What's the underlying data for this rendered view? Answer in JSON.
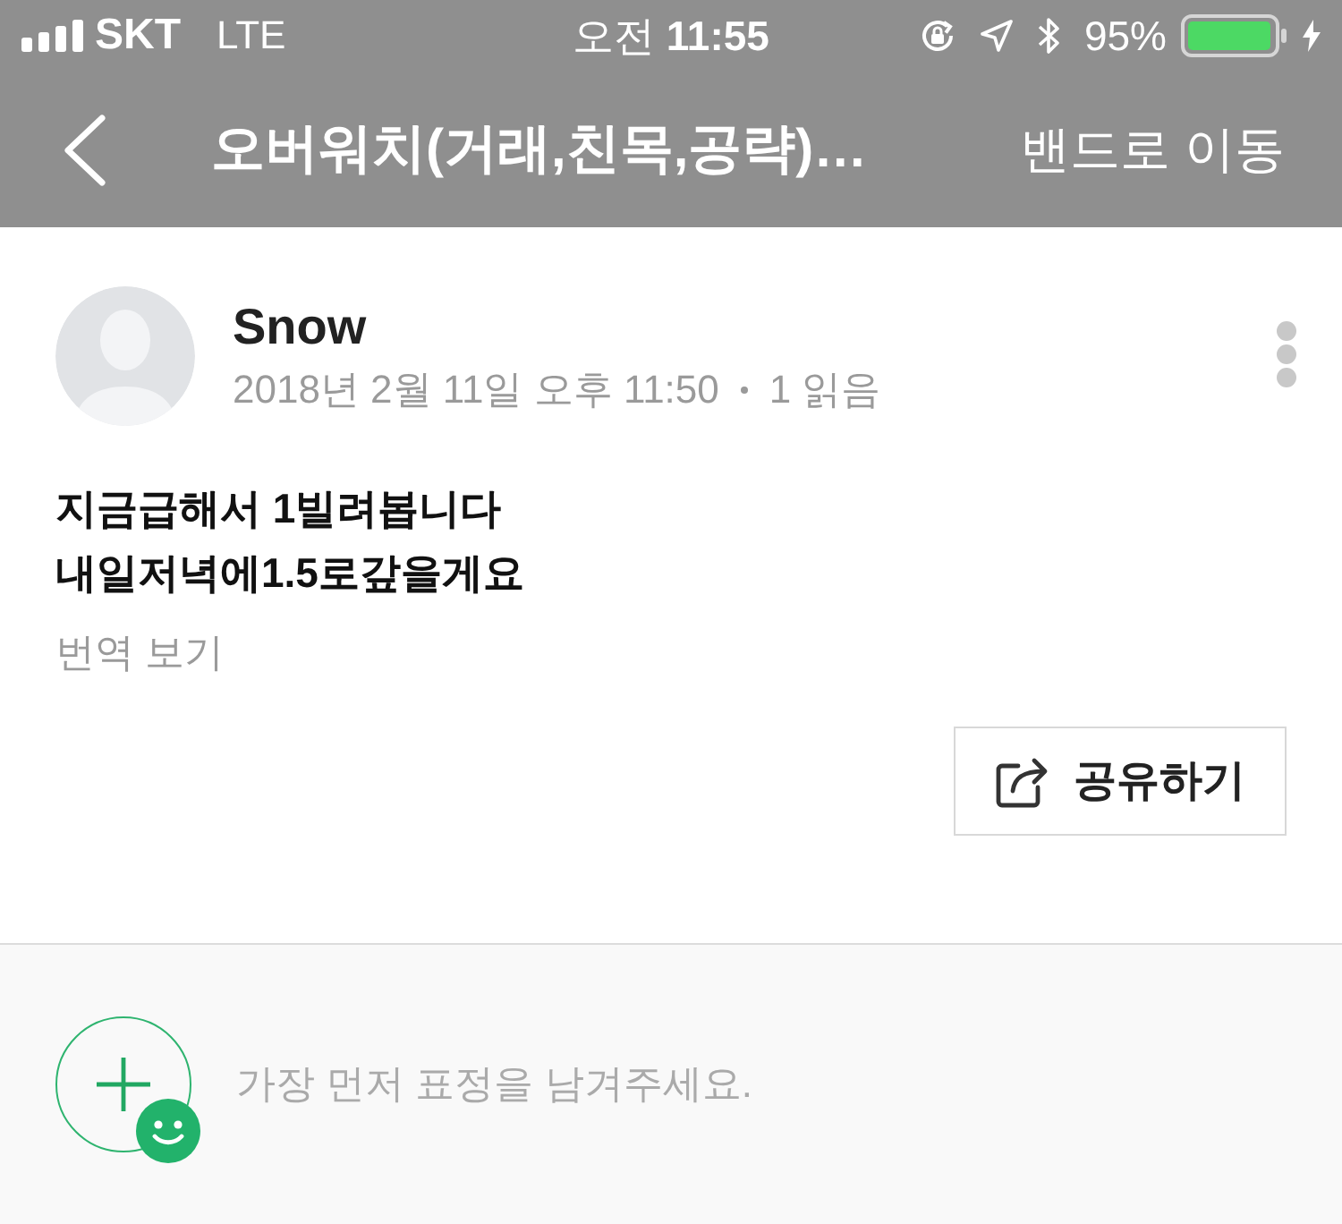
{
  "status_bar": {
    "carrier": "SKT",
    "network": "LTE",
    "time": "오전 **11:55**",
    "battery": "95%"
  },
  "nav_bar": {
    "title": "오버워치(거래,친목,공략)…",
    "action": "밴드로 이동"
  },
  "post": {
    "author": "Snow",
    "date": "2018년 2월 11일 오후 11:50",
    "read_count": "1 읽음",
    "body": [
      "지금급해서 1빌려봅니다",
      "내일저녁에1.5로갚을게요"
    ],
    "translate": "번역 보기",
    "share": "공유하기"
  },
  "reactions": {
    "prompt": "가장 먼저 표정을 남겨주세요."
  }
}
